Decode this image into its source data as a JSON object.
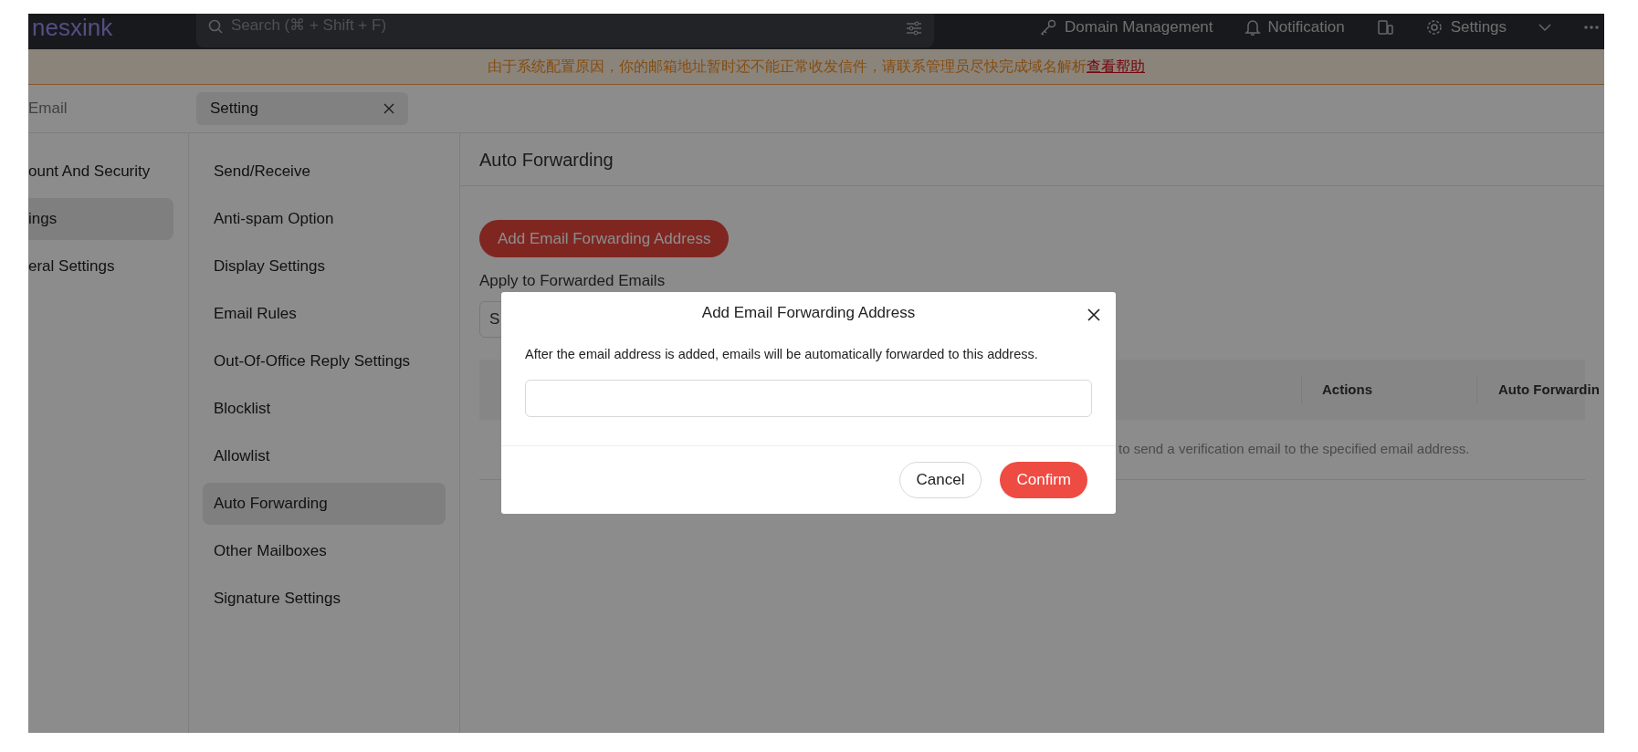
{
  "top_bar": {
    "logo": "nesxink",
    "search": {
      "placeholder": "Search (⌘ + Shift + F)"
    },
    "actions": [
      {
        "kind": "domain",
        "label": "Domain Management"
      },
      {
        "kind": "notification",
        "label": "Notification"
      },
      {
        "kind": "devices"
      },
      {
        "kind": "settings",
        "label": "Settings"
      },
      {
        "kind": "chevron"
      },
      {
        "kind": "more"
      }
    ]
  },
  "banner": {
    "message": "由于系统配置原因，你的邮箱地址暂时还不能正常收发信件，请联系管理员尽快完成域名解析",
    "link": "查看帮助"
  },
  "tabs": [
    {
      "label": "Email",
      "selected": false,
      "closable": false
    },
    {
      "label": "Setting",
      "selected": true,
      "closable": true
    }
  ],
  "sidebar": {
    "items": [
      {
        "label": "ount And Security",
        "selected": false
      },
      {
        "label": "ings",
        "selected": true
      },
      {
        "label": "eral Settings",
        "selected": false
      }
    ]
  },
  "submenu": {
    "items": [
      {
        "label": "Send/Receive",
        "selected": false
      },
      {
        "label": "Anti-spam Option",
        "selected": false
      },
      {
        "label": "Display Settings",
        "selected": false
      },
      {
        "label": "Email Rules",
        "selected": false
      },
      {
        "label": "Out-Of-Office Reply Settings",
        "selected": false
      },
      {
        "label": "Blocklist",
        "selected": false
      },
      {
        "label": "Allowlist",
        "selected": false
      },
      {
        "label": "Auto Forwarding",
        "selected": true
      },
      {
        "label": "Other Mailboxes",
        "selected": false
      },
      {
        "label": "Signature Settings",
        "selected": false
      }
    ]
  },
  "content": {
    "title": "Auto Forwarding",
    "add_button": "Add Email Forwarding Address",
    "apply_label": "Apply to Forwarded Emails",
    "apply_select": {
      "value": "S"
    },
    "table": {
      "columns": [
        "Actions",
        "Auto Forwardin"
      ],
      "rows": [
        [
          "to send a verification email to the specified email address."
        ]
      ]
    }
  },
  "dialog": {
    "title": "Add Email Forwarding Address",
    "description": "After the email address is added, emails will be automatically forwarded to this address.",
    "buttons": [
      {
        "kind": "secondary",
        "label": "Cancel"
      },
      {
        "kind": "primary",
        "label": "Confirm"
      }
    ]
  }
}
